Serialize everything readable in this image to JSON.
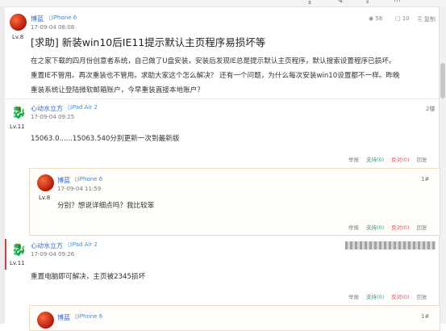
{
  "post": {
    "author": "博蓝",
    "device": "iPhone 6",
    "date": "17-09-04 08:08",
    "level": "Lv.8",
    "views": "58",
    "replies": "10",
    "share": "复制",
    "title": "[求助] 新装win10后IE11提示默认主页程序易损坏等",
    "body_lines": [
      "在之家下载的四月份创意者系统，自己做了U盘安装，安装后发现IE总是提示默认主页程序，默认搜索设置程序已损坏。",
      "重置IE不管用。再次重装也不管用。求助大家这个怎么解决？ 还有一个问题，为什么每次安装win10设置都不一样。昨晚",
      "重装系统让登陆微软邮箱账户，今早重装直接本地账户？"
    ]
  },
  "actions": {
    "report": "举报",
    "support": "支持(0)",
    "oppose": "反对(0)",
    "reply": "回复"
  },
  "replies": [
    {
      "author": "心动水立方",
      "device": "iPad Air 2",
      "date": "17-09-04 09:25",
      "level": "Lv.11",
      "floor": "2楼",
      "text": "15063.0......15063.540分别更新一次到最新版"
    },
    {
      "author": "博蓝",
      "device": "iPhone 6",
      "date": "17-09-04 11:59",
      "level": "Lv.8",
      "floor": "1#",
      "text": "分别？想说详细点吗？我比较笨"
    },
    {
      "author": "心动水立方",
      "device": "iPad Air 2",
      "date": "17-09-04 09:26",
      "level": "Lv.11",
      "floor": "",
      "text": "重置电脑即可解决，主页被2345损坏"
    },
    {
      "author": "博蓝",
      "device": "iPhone 6",
      "floor": "1#"
    }
  ]
}
